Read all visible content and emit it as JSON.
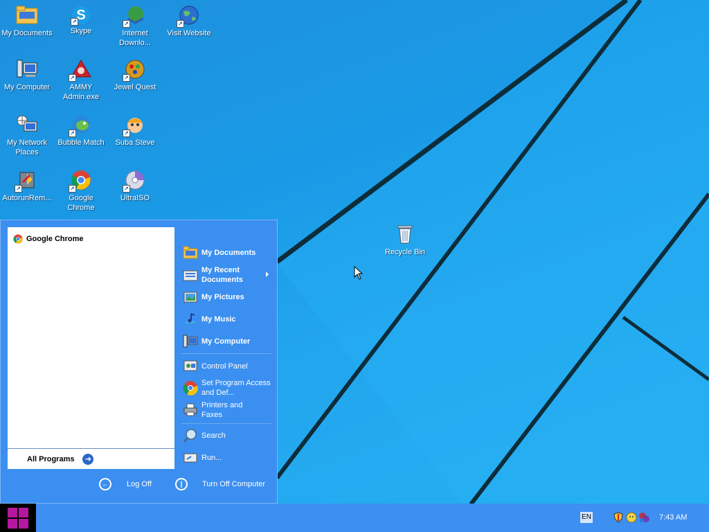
{
  "desktop": {
    "icons": [
      {
        "label": "My Documents",
        "icon": "folder-documents-icon"
      },
      {
        "label": "Skype",
        "icon": "skype-icon"
      },
      {
        "label": "Internet Downlo...",
        "icon": "internet-download-manager-icon"
      },
      {
        "label": "Visit Website",
        "icon": "globe-icon"
      },
      {
        "label": "My Computer",
        "icon": "computer-icon"
      },
      {
        "label": "AMMY Admin.exe",
        "icon": "ammy-admin-icon"
      },
      {
        "label": "Jewel Quest",
        "icon": "jewel-quest-icon"
      },
      {
        "label": "My Network Places",
        "icon": "network-places-icon"
      },
      {
        "label": "Bubble Match",
        "icon": "bubble-match-icon"
      },
      {
        "label": "Suba Steve",
        "icon": "suba-steve-icon"
      },
      {
        "label": "AutorunRem...",
        "icon": "autorun-remover-icon"
      },
      {
        "label": "Google Chrome",
        "icon": "chrome-icon"
      },
      {
        "label": "UltraISO",
        "icon": "ultraiso-icon"
      },
      {
        "label": "Recycle Bin",
        "icon": "recycle-bin-icon"
      }
    ]
  },
  "start_menu": {
    "pinned": [
      {
        "label": "Google Chrome",
        "icon": "chrome-icon"
      }
    ],
    "all_programs": "All Programs",
    "right": {
      "my_documents": "My Documents",
      "my_recent_documents": "My Recent Documents",
      "my_pictures": "My Pictures",
      "my_music": "My Music",
      "my_computer": "My Computer",
      "control_panel": "Control Panel",
      "set_program_access": "Set Program Access and Def...",
      "printers_and_faxes": "Printers and Faxes",
      "search": "Search",
      "run": "Run..."
    },
    "log_off": "Log Off",
    "turn_off": "Turn Off Computer"
  },
  "taskbar": {
    "language": "EN",
    "clock": "7:43 AM",
    "colors": {
      "start_button_bg": "#000000",
      "windows_logo": "#b5179e",
      "taskbar_bg": "#3d8ff2"
    }
  }
}
